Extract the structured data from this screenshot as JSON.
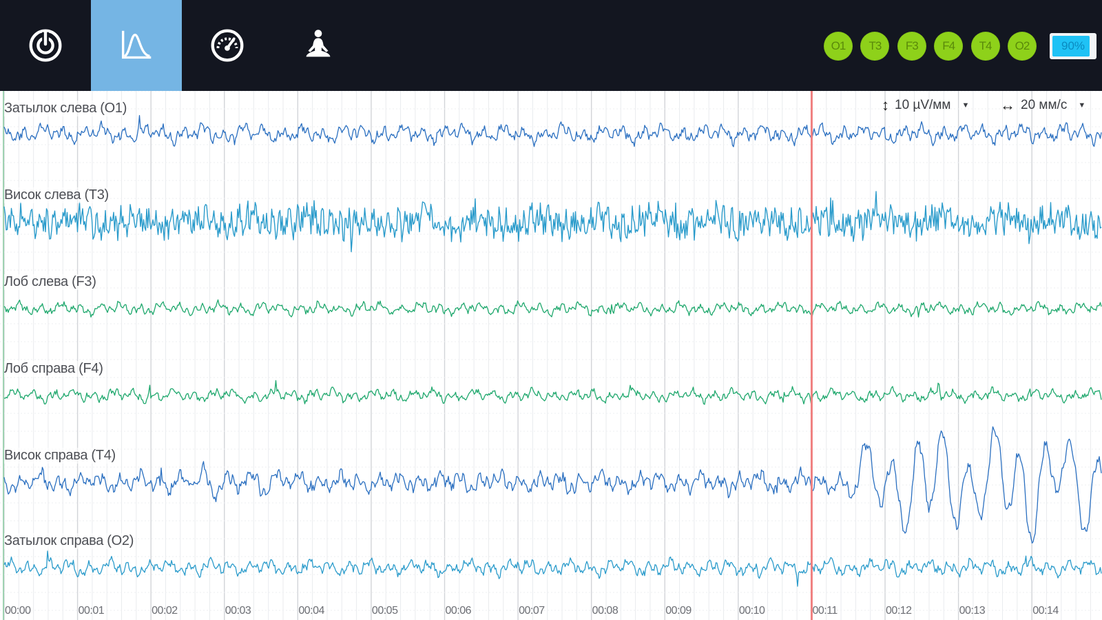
{
  "nav": {
    "tabs": [
      {
        "name": "power",
        "icon": "power-icon",
        "active": false
      },
      {
        "name": "waveform",
        "icon": "waveform-icon",
        "active": true
      },
      {
        "name": "gauge",
        "icon": "gauge-icon",
        "active": false
      },
      {
        "name": "meditation",
        "icon": "meditation-icon",
        "active": false
      }
    ],
    "active_color": "#75b5e4",
    "bar_color": "#131620"
  },
  "status": {
    "electrodes": [
      "O1",
      "T3",
      "F3",
      "F4",
      "T4",
      "O2"
    ],
    "electrode_color": "#8ed11a",
    "battery_label": "90%",
    "battery_level": 0.9,
    "battery_color": "#1fc2f5"
  },
  "controls": {
    "amplitude": "10 µV/мм",
    "speed": "20 мм/с"
  },
  "cursor_time": 11,
  "cursor_color": "#f08080",
  "chart_data": {
    "type": "line",
    "x_unit": "s",
    "xlim": [
      0,
      15
    ],
    "x_ticks": [
      "00:00",
      "00:01",
      "00:02",
      "00:03",
      "00:04",
      "00:05",
      "00:06",
      "00:07",
      "00:08",
      "00:09",
      "00:10",
      "00:11",
      "00:12",
      "00:13",
      "00:14"
    ],
    "grid": true,
    "series": [
      {
        "name": "Затылок слева (O1)",
        "color": "#2a6fc0",
        "amplitude": 1.0,
        "character": "alpha, low-amplitude"
      },
      {
        "name": "Висок слева (T3)",
        "color": "#2a9bcb",
        "amplitude": 2.2,
        "character": "high-frequency, dense"
      },
      {
        "name": "Лоб слева (F3)",
        "color": "#1fa86d",
        "amplitude": 0.7,
        "character": "low-amplitude"
      },
      {
        "name": "Лоб справа (F4)",
        "color": "#1fa86d",
        "amplitude": 0.7,
        "character": "low-amplitude"
      },
      {
        "name": "Висок справа (T4)",
        "color": "#2a6fc0",
        "amplitude": 1.2,
        "character": "large slow waves after 00:11"
      },
      {
        "name": "Затылок справа (O2)",
        "color": "#2a9bcb",
        "amplitude": 0.9,
        "character": "low-amplitude"
      }
    ]
  }
}
